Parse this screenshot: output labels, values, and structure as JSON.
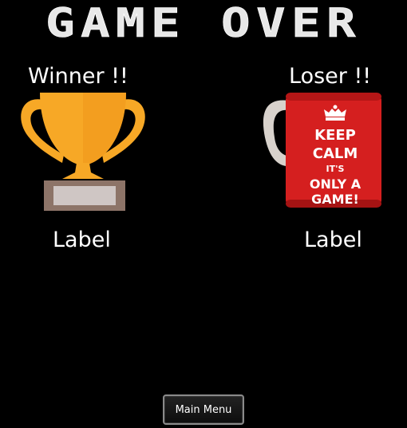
{
  "title": "GAME OVER",
  "winner": {
    "heading": "Winner !!",
    "label": "Label",
    "icon": "trophy-icon"
  },
  "loser": {
    "heading": "Loser !!",
    "label": "Label",
    "icon": "mug-icon",
    "mug_text": [
      "KEEP",
      "CALM",
      "IT'S",
      "ONLY A",
      "GAME!"
    ]
  },
  "main_menu_label": "Main Menu",
  "colors": {
    "background": "#000000",
    "title": "#e8e8e8",
    "trophy_gold": "#f7a826",
    "mug_red": "#d51f1f",
    "button_border": "#8a8a8a"
  }
}
